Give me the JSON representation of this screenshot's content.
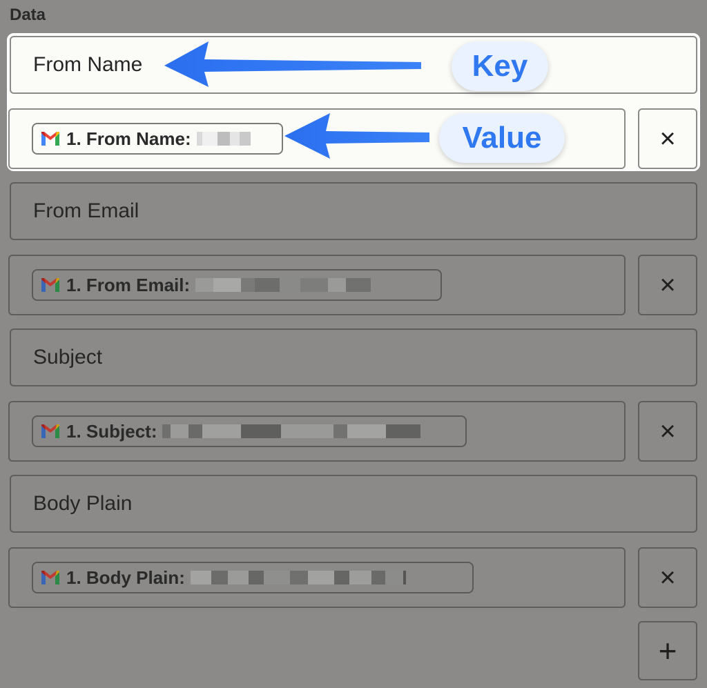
{
  "section": {
    "label": "Data"
  },
  "rows": [
    {
      "key": "From Name",
      "value_label": "1. From Name:"
    },
    {
      "key": "From Email",
      "value_label": "1. From Email:"
    },
    {
      "key": "Subject",
      "value_label": "1. Subject:"
    },
    {
      "key": "Body Plain",
      "value_label": "1. Body Plain:"
    }
  ],
  "callouts": {
    "key": "Key",
    "value": "Value"
  },
  "icons": {
    "remove": "×",
    "add": "+",
    "gmail": "gmail-icon"
  },
  "colors": {
    "accent": "#2f78ef",
    "overlay": "#8b8a88",
    "highlight": "#fcfcf9"
  }
}
